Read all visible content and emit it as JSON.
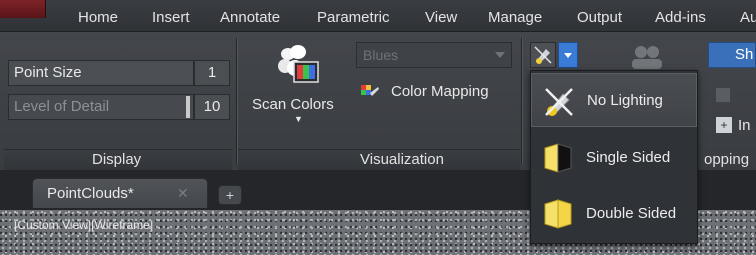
{
  "menubar": {
    "tabs": [
      "Home",
      "Insert",
      "Annotate",
      "Parametric",
      "View",
      "Manage",
      "Output",
      "Add-ins",
      "Au"
    ]
  },
  "display_panel": {
    "title": "Display",
    "point_size": {
      "label": "Point Size",
      "value": "1"
    },
    "level_of_detail": {
      "label": "Level of Detail",
      "value": "10"
    }
  },
  "visualization_panel": {
    "title": "Visualization",
    "scan_colors_label": "Scan Colors",
    "color_scheme_value": "Blues",
    "color_mapping_label": "Color Mapping"
  },
  "right_panel": {
    "title_partial": "opping",
    "button_partial": "Sh",
    "button2_partial": "In"
  },
  "lighting_menu": {
    "items": [
      {
        "label": "No Lighting",
        "icon": "no-lighting-icon",
        "highlighted": true
      },
      {
        "label": "Single Sided",
        "icon": "single-sided-lighting-icon",
        "highlighted": false
      },
      {
        "label": "Double Sided",
        "icon": "double-sided-lighting-icon",
        "highlighted": false
      }
    ]
  },
  "document_tabs": {
    "active": "PointClouds*",
    "new_tab_symbol": "+"
  },
  "viewport": {
    "label": "[Custom View][Wireframe]"
  },
  "colors": {
    "ribbon_bg": "#43464b",
    "accent_blue": "#3a7bd5",
    "app_button_red": "#7d2328"
  }
}
